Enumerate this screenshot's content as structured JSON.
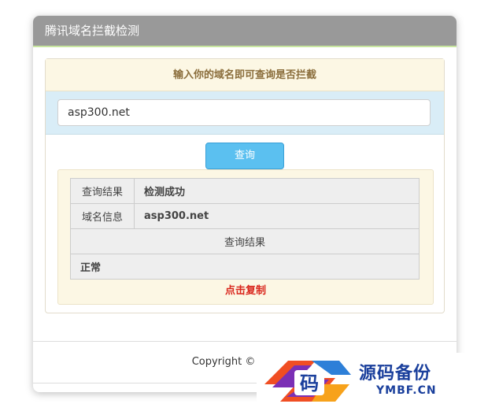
{
  "header": {
    "title": "腾讯域名拦截检测"
  },
  "panel": {
    "heading": "输入你的域名即可查询是否拦截",
    "domain_input_value": "asp300.net",
    "query_button": "查询"
  },
  "result": {
    "row1_label": "查询结果",
    "row1_value": "检测成功",
    "row2_label": "域名信息",
    "row2_value": "asp300.net",
    "section_header": "查询结果",
    "status": "正常",
    "copy_link": "点击复制"
  },
  "footer": {
    "copyright": "Copyright © ASP300"
  },
  "watermark": {
    "logo_char": "码",
    "name": "源码备份",
    "url": "YMBF.CN"
  },
  "colors": {
    "header_bg": "#999999",
    "panel_head_bg": "#fcf7e4",
    "input_zone_bg": "#d9edf7",
    "button_bg": "#5bc0f0",
    "copy_link": "#d9261c",
    "watermark_blue": "#1a3f9c"
  }
}
